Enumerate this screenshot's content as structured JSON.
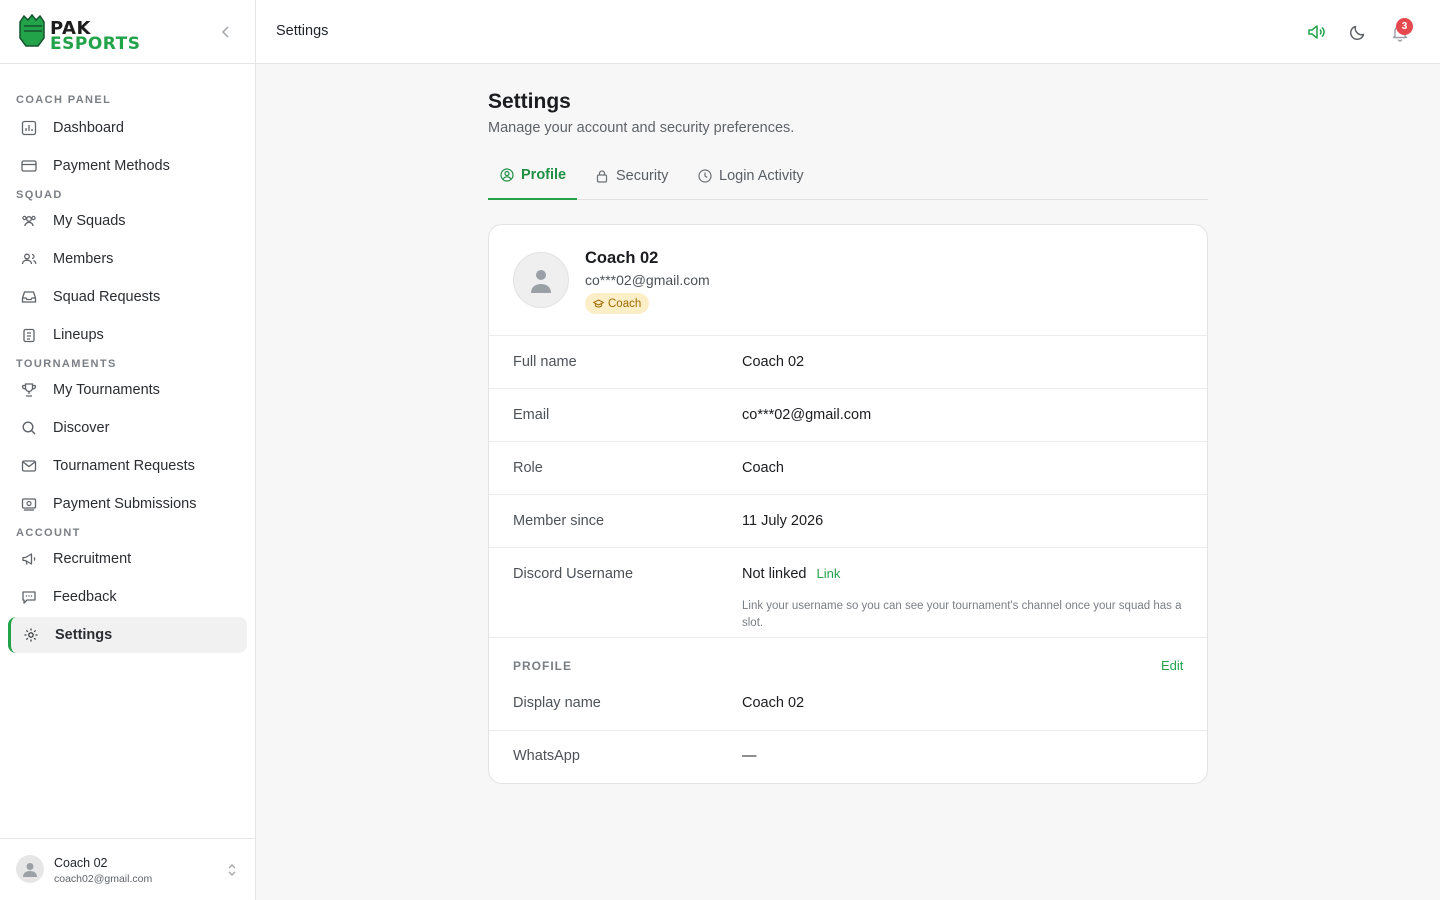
{
  "brand": {
    "line1": "PAK",
    "line2": "ESPORTS"
  },
  "topbar": {
    "title": "Settings",
    "notification_count": "3"
  },
  "sidebar": {
    "sections": {
      "coach": "COACH PANEL",
      "squad": "SQUAD",
      "tournaments": "TOURNAMENTS",
      "account": "ACCOUNT"
    },
    "items": [
      {
        "label": "Dashboard"
      },
      {
        "label": "Payment Methods"
      },
      {
        "label": "My Squads"
      },
      {
        "label": "Members"
      },
      {
        "label": "Squad Requests"
      },
      {
        "label": "Lineups"
      },
      {
        "label": "My Tournaments"
      },
      {
        "label": "Discover"
      },
      {
        "label": "Tournament Requests"
      },
      {
        "label": "Payment Submissions"
      },
      {
        "label": "Recruitment"
      },
      {
        "label": "Feedback"
      },
      {
        "label": "Settings"
      }
    ],
    "user": {
      "name": "Coach 02",
      "email": "coach02@gmail.com"
    }
  },
  "page": {
    "title": "Settings",
    "subtitle": "Manage your account and security preferences.",
    "tabs": [
      {
        "label": "Profile"
      },
      {
        "label": "Security"
      },
      {
        "label": "Login Activity"
      }
    ]
  },
  "profile": {
    "name": "Coach 02",
    "email": "co***02@gmail.com",
    "role_badge": "Coach",
    "fields": [
      {
        "key": "Full name",
        "value": "Coach 02"
      },
      {
        "key": "Email",
        "value": "co***02@gmail.com"
      },
      {
        "key": "Role",
        "value": "Coach"
      },
      {
        "key": "Member since",
        "value": "11 July 2026"
      },
      {
        "key": "Discord Username",
        "value": "Not linked"
      }
    ],
    "discord_link": "Link",
    "discord_hint": "Link your username so you can see your tournament's channel once your squad has a slot.",
    "section_label": "PROFILE",
    "edit_label": "Edit",
    "profile_fields": [
      {
        "key": "Display name",
        "value": "Coach 02"
      },
      {
        "key": "WhatsApp",
        "value": "—"
      }
    ]
  },
  "colors": {
    "accent": "#22a34a",
    "badge": "#e5484d",
    "role_badge_bg": "#fcefc7"
  }
}
